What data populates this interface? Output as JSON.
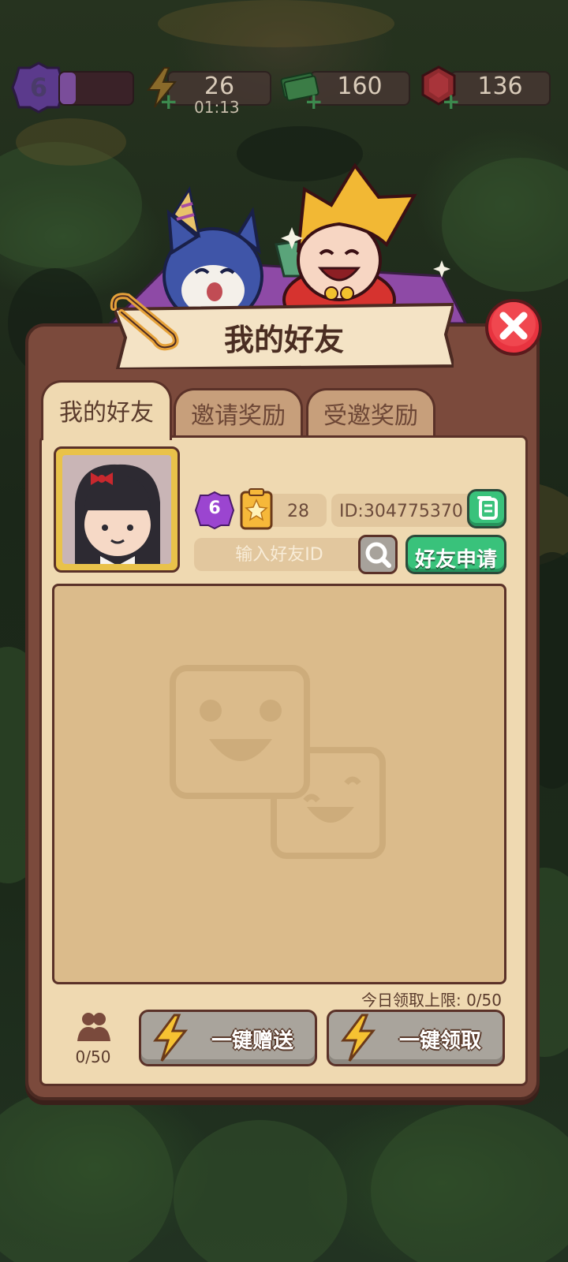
{
  "hud": {
    "level": "6",
    "energy": "26",
    "energy_timer": "01:13",
    "cash": "160",
    "gems": "136"
  },
  "dialog": {
    "title": "我的好友",
    "tabs": [
      "我的好友",
      "邀请奖励",
      "受邀奖励"
    ],
    "active_tab": 0
  },
  "profile": {
    "level": "6",
    "stars": "28",
    "id_text": "ID:304775370"
  },
  "search": {
    "placeholder": "输入好友ID",
    "value": ""
  },
  "friend_request_label": "好友申请",
  "daily_limit": "今日领取上限: 0/50",
  "friend_count": "0/50",
  "buttons": {
    "send_all": "一键赠送",
    "claim_all": "一键领取"
  },
  "colors": {
    "panel": "#efd9b1",
    "frame": "#7b4a3c",
    "green": "#39c27b",
    "close_red": "#e8333f"
  }
}
